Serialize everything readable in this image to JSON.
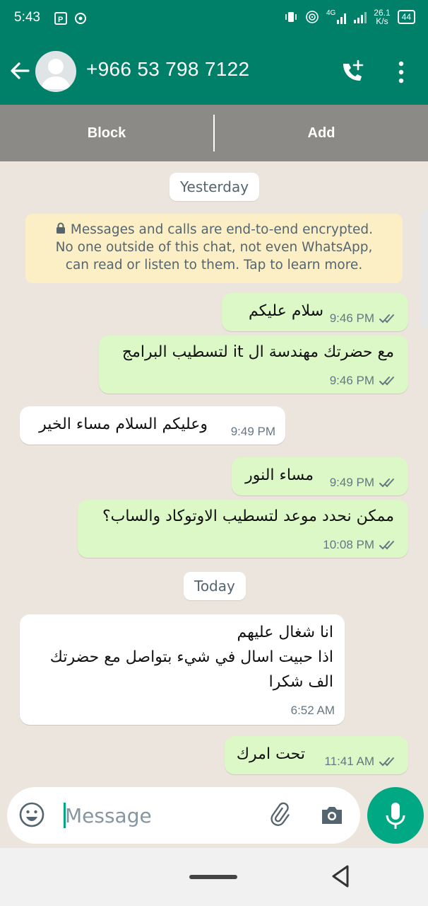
{
  "status_bar": {
    "time": "5:43",
    "network_speed_value": "26.1",
    "network_speed_unit": "K/s",
    "battery": "44",
    "signal_label": "4G"
  },
  "header": {
    "contact_name": "+966 53 798 7122",
    "icons": [
      "back-arrow-icon",
      "avatar-icon",
      "add-call-icon",
      "more-vert-icon"
    ]
  },
  "action_bar": {
    "block_label": "Block",
    "add_label": "Add"
  },
  "chat": {
    "date_yesterday": "Yesterday",
    "encryption_line1": "Messages and calls are end-to-end encrypted.",
    "encryption_line2": "No one outside of this chat, not even WhatsApp,",
    "encryption_line3": "can read or listen to them. Tap to learn more.",
    "date_today": "Today",
    "messages": [
      {
        "direction": "out",
        "text": "سلام عليكم",
        "time": "9:46 PM",
        "status": "read"
      },
      {
        "direction": "out",
        "text": "مع حضرتك مهندسة ال it لتسطيب البرامج",
        "time": "9:46 PM",
        "status": "read"
      },
      {
        "direction": "in",
        "text": "وعليكم السلام مساء الخير",
        "time": "9:49 PM"
      },
      {
        "direction": "out",
        "text": "مساء النور",
        "time": "9:49 PM",
        "status": "read"
      },
      {
        "direction": "out",
        "text": "ممكن نحدد موعد لتسطيب الاوتوكاد والساب؟",
        "time": "10:08 PM",
        "status": "read"
      },
      {
        "direction": "in",
        "lines": [
          "انا شغال عليهم",
          "اذا حبيت اسال في شيء بتواصل مع حضرتك",
          "الف شكرا"
        ],
        "time": "6:52 AM"
      },
      {
        "direction": "out",
        "text": "تحت امرك",
        "time": "11:41 AM",
        "status": "read"
      }
    ]
  },
  "input": {
    "placeholder": "Message",
    "icons": [
      "emoji-icon",
      "attach-icon",
      "camera-icon",
      "mic-icon"
    ]
  },
  "colors": {
    "brand": "#008069",
    "accent": "#00a884",
    "outgoing_bubble": "#dcf8c6",
    "incoming_bubble": "#ffffff",
    "chat_bg": "#ece5dd",
    "read_tick": "#667781"
  }
}
